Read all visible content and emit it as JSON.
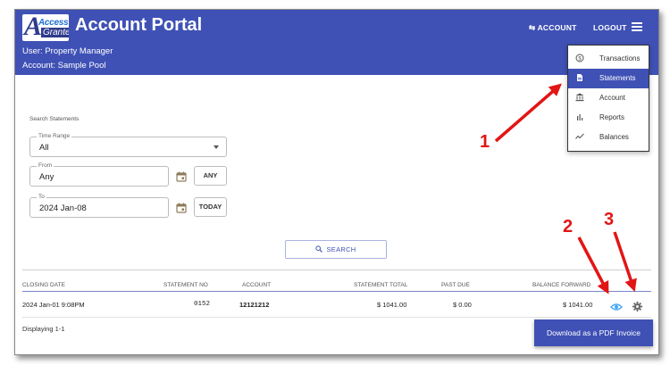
{
  "header": {
    "app_title": "Account Portal",
    "logo_text_top": "Access",
    "logo_text_bottom": "Granted",
    "user_line": "User: Property Manager",
    "account_line": "Account: Sample Pool",
    "account_link": "⇆ ACCOUNT",
    "logout_link": "LOGOUT",
    "menu_icon": "hamburger-icon"
  },
  "menu": {
    "items": [
      {
        "label": "Transactions",
        "icon": "dollar-circle-icon",
        "active": false
      },
      {
        "label": "Statements",
        "icon": "document-icon",
        "active": true
      },
      {
        "label": "Account",
        "icon": "bank-icon",
        "active": false
      },
      {
        "label": "Reports",
        "icon": "bar-chart-icon",
        "active": false
      },
      {
        "label": "Balances",
        "icon": "line-chart-icon",
        "active": false
      }
    ]
  },
  "search": {
    "section_label": "Search Statements",
    "time_range_legend": "Time Range",
    "time_range_value": "All",
    "from_legend": "From",
    "from_value": "Any",
    "any_button": "ANY",
    "to_legend": "To",
    "to_value": "2024 Jan-08",
    "today_button": "TODAY",
    "search_button": "SEARCH"
  },
  "table": {
    "headers": [
      "CLOSING DATE",
      "STATEMENT NO",
      "ACCOUNT",
      "STATEMENT TOTAL",
      "PAST DUE",
      "BALANCE FORWARD"
    ],
    "rows": [
      {
        "closing_date": "2024 Jan-01 9:08PM",
        "statement_no": "0152",
        "account": "12121212",
        "statement_total": "$ 1041.00",
        "past_due": "$ 0.00",
        "balance_forward": "$ 1041.00"
      }
    ],
    "displaying": "Displaying 1-1",
    "pdf_button": "Download as a PDF Invoice"
  },
  "annotations": {
    "n1": "1",
    "n2": "2",
    "n3": "3",
    "color": "#e21515"
  },
  "colors": {
    "brand": "#3f51b5",
    "view_icon": "#42a5f5"
  }
}
